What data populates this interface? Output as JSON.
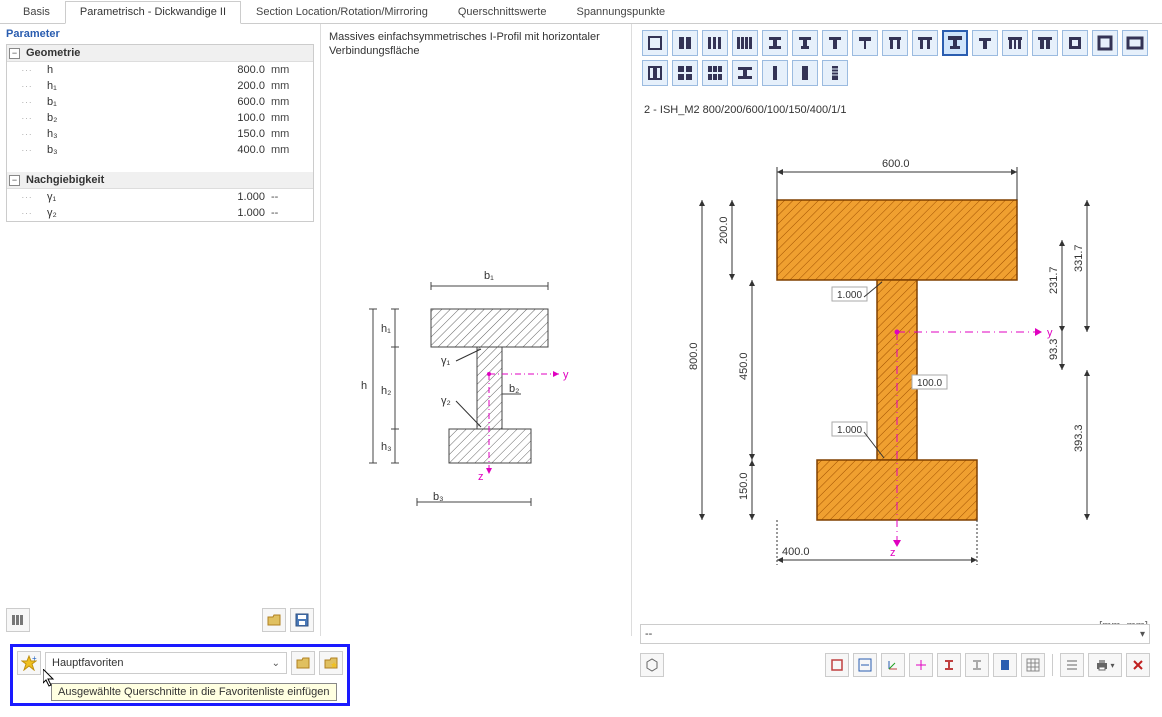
{
  "tabs": [
    {
      "label": "Basis"
    },
    {
      "label": "Parametrisch - Dickwandige II"
    },
    {
      "label": "Section Location/Rotation/Mirroring"
    },
    {
      "label": "Querschnittswerte"
    },
    {
      "label": "Spannungspunkte"
    }
  ],
  "parameter_header": "Parameter",
  "groups": {
    "geometry_title": "Geometrie",
    "compliance_title": "Nachgiebigkeit"
  },
  "geom": [
    {
      "name": "h",
      "value": "800.0",
      "unit": "mm"
    },
    {
      "name": "h₁",
      "value": "200.0",
      "unit": "mm"
    },
    {
      "name": "b₁",
      "value": "600.0",
      "unit": "mm"
    },
    {
      "name": "b₂",
      "value": "100.0",
      "unit": "mm"
    },
    {
      "name": "h₃",
      "value": "150.0",
      "unit": "mm"
    },
    {
      "name": "b₃",
      "value": "400.0",
      "unit": "mm"
    }
  ],
  "comp": [
    {
      "name": "γ₁",
      "value": "1.000",
      "unit": "--"
    },
    {
      "name": "γ₂",
      "value": "1.000",
      "unit": "--"
    }
  ],
  "mid_title": "Massives einfachsymmetrisches I-Profil mit horizontaler Verbindungsfläche",
  "mid_labels": {
    "b1": "b₁",
    "b2": "b₂",
    "b3": "b₃",
    "h": "h",
    "h1": "h₁",
    "h2": "h₂",
    "h3": "h₃",
    "g1": "γ₁",
    "g2": "γ₂",
    "y": "y",
    "z": "z"
  },
  "right_title": "2 - ISH_M2 800/200/600/100/150/400/1/1",
  "dims": {
    "b1": "600.0",
    "h1": "200.0",
    "h": "800.0",
    "h2": "450.0",
    "b2": "100.0",
    "h3": "150.0",
    "b3": "400.0",
    "g1": "1.000",
    "g2": "1.000",
    "y": "y",
    "z": "z",
    "e_top": "331.7",
    "e_mid": "231.7",
    "e_low": "93.3",
    "e_bot": "393.3"
  },
  "unit_label": "[mm, mm]",
  "status_value": "--",
  "favorites": {
    "combo_label": "Hauptfavoriten",
    "tooltip": "Ausgewählte Querschnitte in die Favoritenliste einfügen"
  }
}
